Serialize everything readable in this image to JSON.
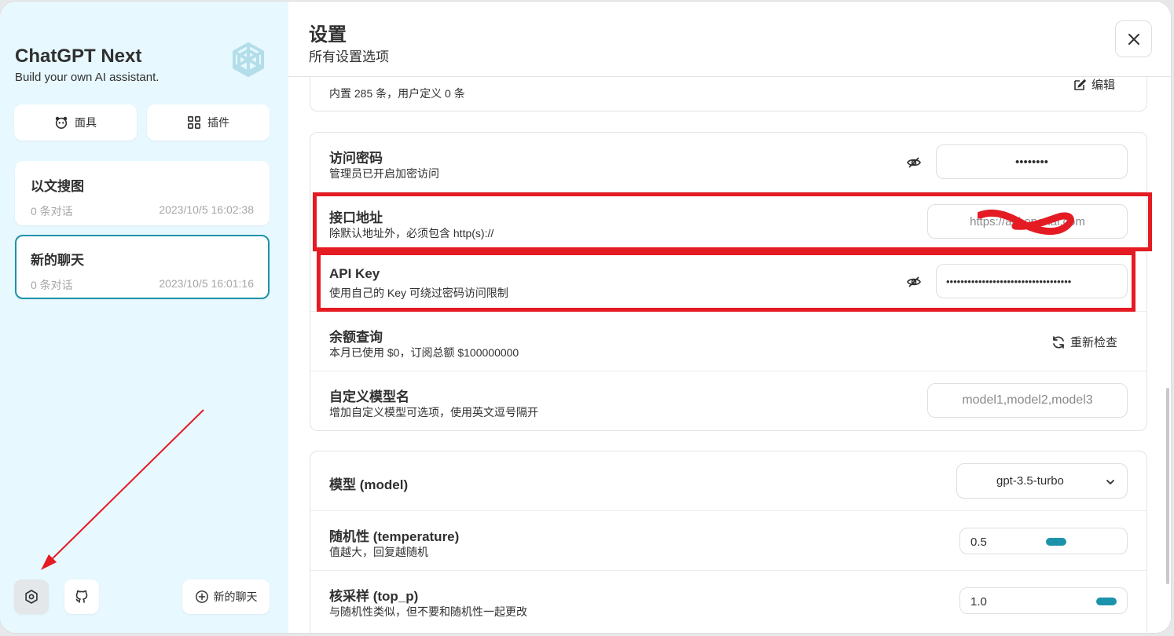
{
  "sidebar": {
    "title": "ChatGPT Next",
    "subtitle": "Build your own AI assistant.",
    "mask_button": "面具",
    "plugin_button": "插件",
    "chats": [
      {
        "title": "以文搜图",
        "count": "0 条对话",
        "time": "2023/10/5 16:02:38"
      },
      {
        "title": "新的聊天",
        "count": "0 条对话",
        "time": "2023/10/5 16:01:16"
      }
    ],
    "new_chat_button": "新的聊天"
  },
  "header": {
    "title": "设置",
    "subtitle": "所有设置选项"
  },
  "settings": {
    "prompt_list": {
      "sub": "内置 285 条，用户定义 0 条",
      "action": "编辑"
    },
    "access_code": {
      "title": "访问密码",
      "sub": "管理员已开启加密访问",
      "value": "••••••••"
    },
    "endpoint": {
      "title": "接口地址",
      "sub": "除默认地址外，必须包含 http(s)://",
      "value": "https://api.openai.com"
    },
    "api_key": {
      "title": "API Key",
      "sub": "使用自己的 Key 可绕过密码访问限制",
      "value": "•••••••••••••••••••••••••••••••••••"
    },
    "usage": {
      "title": "余额查询",
      "sub": "本月已使用 $0，订阅总额 $100000000",
      "action": "重新检查"
    },
    "custom_models": {
      "title": "自定义模型名",
      "sub": "增加自定义模型可选项，使用英文逗号隔开",
      "placeholder": "model1,model2,model3"
    },
    "model": {
      "title": "模型 (model)",
      "value": "gpt-3.5-turbo"
    },
    "temperature": {
      "title": "随机性 (temperature)",
      "sub": "值越大，回复越随机",
      "value": "0.5",
      "level": 0.5
    },
    "top_p": {
      "title": "核采样 (top_p)",
      "sub": "与随机性类似，但不要和随机性一起更改",
      "value": "1.0",
      "level": 1.0
    }
  },
  "colors": {
    "accent": "#1d93ab",
    "annotation_red": "#e51b23",
    "sidebar_bg": "#e7f8ff"
  }
}
